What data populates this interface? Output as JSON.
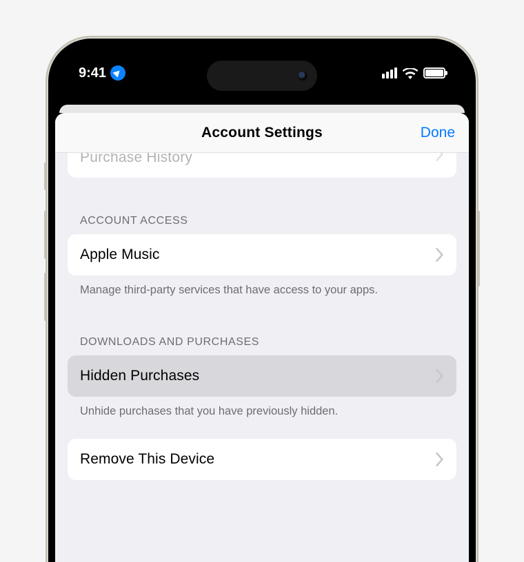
{
  "status": {
    "time": "9:41"
  },
  "modal": {
    "title": "Account Settings",
    "done": "Done"
  },
  "cutoff_row": {
    "label": "Purchase History"
  },
  "section_access": {
    "header": "ACCOUNT ACCESS",
    "row_label": "Apple Music",
    "footer": "Manage third-party services that have access to your apps."
  },
  "section_downloads": {
    "header": "DOWNLOADS AND PURCHASES",
    "row_hidden": "Hidden Purchases",
    "footer": "Unhide purchases that you have previously hidden.",
    "row_remove": "Remove This Device"
  }
}
